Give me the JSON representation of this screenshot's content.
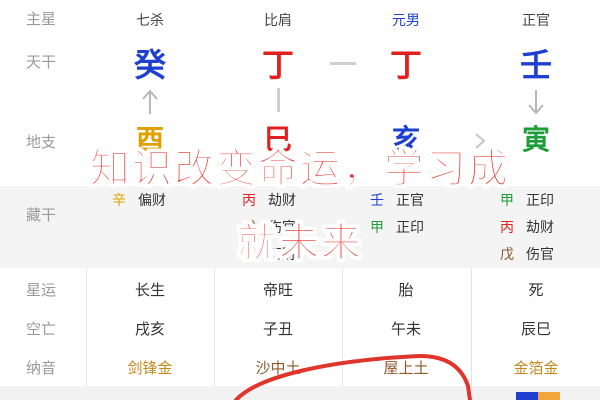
{
  "labels": {
    "zhuxing": "主星",
    "tiangan": "天干",
    "dizhi": "地支",
    "canggan": "藏干",
    "xingyun": "星运",
    "kongwang": "空亡",
    "nayin": "纳音"
  },
  "columns": [
    {
      "star": "七杀",
      "star_color": "#444444",
      "gan": "癸",
      "gan_color": "#1f3fd1",
      "zhi": "酉",
      "zhi_color": "#e0a000",
      "hidden": [
        {
          "stem": "辛",
          "stem_color": "#e0a000",
          "role": "偏财"
        }
      ],
      "xingyun": "长生",
      "kongwang": "戌亥",
      "nayin": "剑锋金",
      "nayin_color": "#c48a1b"
    },
    {
      "star": "比肩",
      "star_color": "#444444",
      "gan": "丁",
      "gan_color": "#e02020",
      "zhi": "巳",
      "zhi_color": "#e02020",
      "hidden": [
        {
          "stem": "丙",
          "stem_color": "#e02020",
          "role": "劫财"
        },
        {
          "stem": "戊",
          "stem_color": "#8b5a2b",
          "role": "伤官"
        },
        {
          "stem": "庚",
          "stem_color": "#e0a000",
          "role": "正财"
        }
      ],
      "xingyun": "帝旺",
      "kongwang": "子丑",
      "nayin": "沙中土",
      "nayin_color": "#8b5a2b"
    },
    {
      "star": "元男",
      "star_color": "#1f3fd1",
      "gan": "丁",
      "gan_color": "#e02020",
      "zhi": "亥",
      "zhi_color": "#1f3fd1",
      "hidden": [
        {
          "stem": "壬",
          "stem_color": "#1f3fd1",
          "role": "正官"
        },
        {
          "stem": "甲",
          "stem_color": "#1e9e3a",
          "role": "正印"
        }
      ],
      "xingyun": "胎",
      "kongwang": "午未",
      "nayin": "屋上土",
      "nayin_color": "#8b5a2b"
    },
    {
      "star": "正官",
      "star_color": "#444444",
      "gan": "壬",
      "gan_color": "#1f3fd1",
      "zhi": "寅",
      "zhi_color": "#1e9e3a",
      "hidden": [
        {
          "stem": "甲",
          "stem_color": "#1e9e3a",
          "role": "正印"
        },
        {
          "stem": "丙",
          "stem_color": "#e02020",
          "role": "劫财"
        },
        {
          "stem": "戊",
          "stem_color": "#8b5a2b",
          "role": "伤官"
        }
      ],
      "xingyun": "死",
      "kongwang": "辰巳",
      "nayin": "金箔金",
      "nayin_color": "#c48a1b"
    }
  ],
  "overlay_text": {
    "line1": "知识改变命运，学习成",
    "line2": "就未来"
  },
  "colors": {
    "overlay_red": "#e8392f",
    "connector_gray": "#cfcfcf",
    "label_gray": "#9a9a9a"
  }
}
